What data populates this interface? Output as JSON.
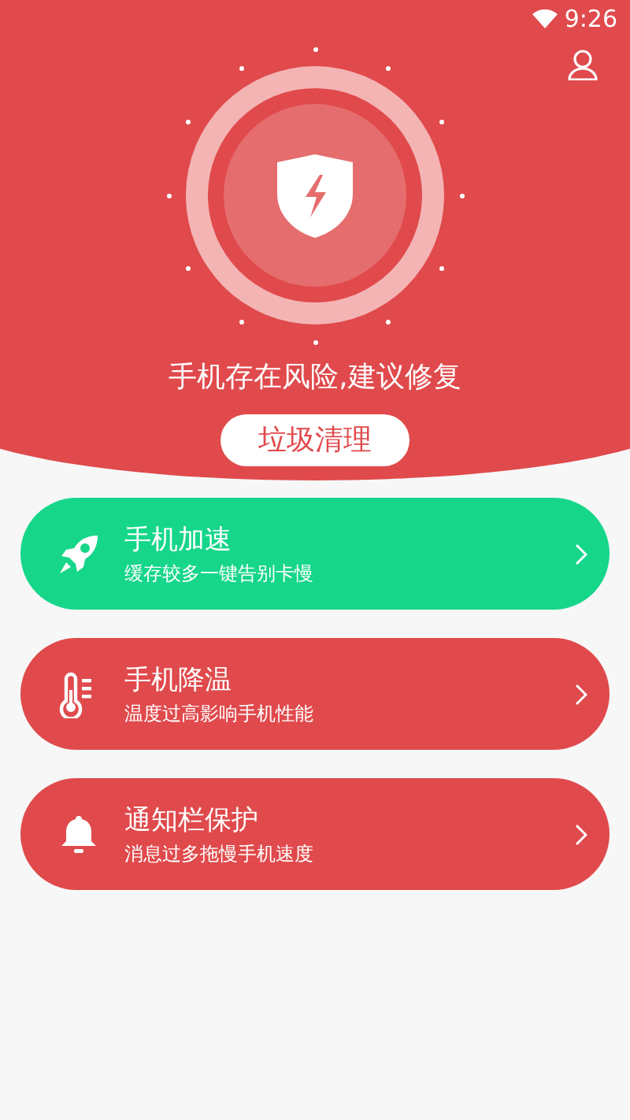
{
  "status_bar": {
    "time": "9:26"
  },
  "hero": {
    "message": "手机存在风险,建议修复",
    "button": "垃圾清理"
  },
  "features": [
    {
      "kind": "rocket",
      "title": "手机加速",
      "subtitle": "缓存较多一键告别卡慢",
      "color": "#16d68a"
    },
    {
      "kind": "thermometer",
      "title": "手机降温",
      "subtitle": "温度过高影响手机性能",
      "color": "#e04a4c"
    },
    {
      "kind": "bell",
      "title": "通知栏保护",
      "subtitle": "消息过多拖慢手机速度",
      "color": "#e04a4c"
    }
  ]
}
